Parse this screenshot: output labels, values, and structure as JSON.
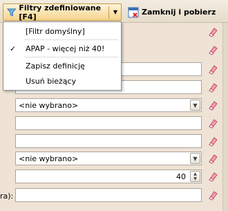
{
  "toolbar": {
    "filters_label": "Filtry zdefiniowane [F4]",
    "close_label": "Zamknij i pobierz"
  },
  "menu": {
    "items": [
      {
        "label": "[Filtr domyślny]",
        "checked": false
      },
      {
        "label": "APAP - więcej niż 40!",
        "checked": true,
        "check": "✓"
      },
      {
        "label": "Zapisz definicję",
        "checked": false
      },
      {
        "label": "Usuń bieżący",
        "checked": false
      }
    ]
  },
  "form": {
    "select_1_value": "<nie wybrano>",
    "select_2_value": "<nie wybrano>",
    "number_value": "40",
    "side_label": "ra):"
  },
  "icons": {
    "filter": "filter-funnel-icon",
    "close": "close-and-fetch-icon",
    "clear": "eraser-icon"
  },
  "colors": {
    "accent": "#f6d48b",
    "background": "#eee3d4"
  }
}
